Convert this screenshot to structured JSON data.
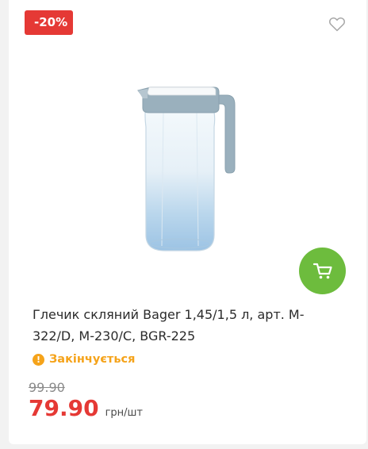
{
  "product": {
    "discount_badge": "-20%",
    "title": "Глечик скляний Bager 1,45/1,5 л, арт. M-322/D, M-230/C, BGR-225",
    "stock_status": "Закінчується",
    "old_price": "99.90",
    "price": "79.90",
    "unit": "грн/шт",
    "image_icon": "glass-jug-image"
  },
  "actions": {
    "favorite_icon": "heart-outline-icon",
    "cart_icon": "shopping-cart-icon"
  },
  "colors": {
    "accent_red": "#e53935",
    "cart_green": "#6dbc3d",
    "warning_orange": "#f5a31a",
    "page_background": "#f2f2f2"
  }
}
